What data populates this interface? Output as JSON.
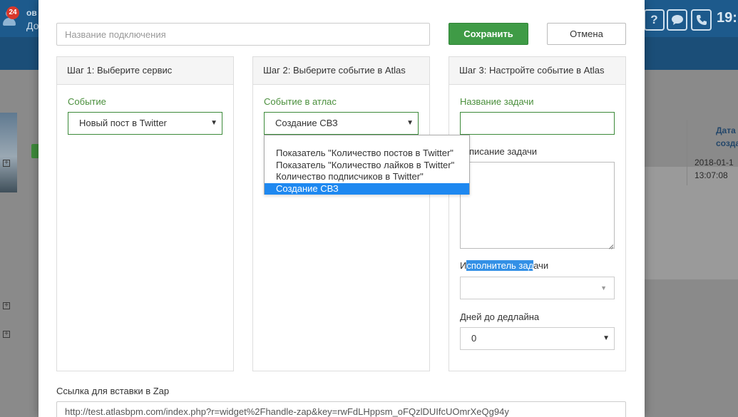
{
  "background": {
    "notification_count": "24",
    "user_line1": "ов",
    "user_line2": "До",
    "toolbar_help": "?",
    "clock": "19:",
    "table_header": "Дата созда",
    "table_cell": "2018-01-1 13:07:08"
  },
  "form": {
    "connection_name_placeholder": "Название подключения",
    "save_label": "Сохранить",
    "cancel_label": "Отмена",
    "zap_link_label": "Ссылка для вставки в Zap",
    "zap_link_value": "http://test.atlasbpm.com/index.php?r=widget%2Fhandle-zap&key=rwFdLHppsm_oFQzlDUIfcUOmrXeQg94y"
  },
  "step1": {
    "title": "Шаг 1: Выберите сервис",
    "event_label": "Событие",
    "event_value": "Новый пост в Twitter"
  },
  "step2": {
    "title": "Шаг 2: Выберите событие в Atlas",
    "event_label": "Событие в атлас",
    "event_value": "Создание СВЗ",
    "options": [
      "Показатель \"Количество постов в Twitter\"",
      "Показатель \"Количество лайков в Twitter\"",
      "Количество подписчиков в Twitter\"",
      "Создание СВЗ"
    ]
  },
  "step3": {
    "title": "Шаг 3: Настройте событие в Atlas",
    "task_name_label": "Название задачи",
    "task_desc_label": "Описание задачи",
    "task_desc_visible": "писание задачи",
    "assignee_label_pre": "И",
    "assignee_label_sel": "сполнитель зад",
    "assignee_label_post": "ачи",
    "deadline_label": "Дней до дедлайна",
    "deadline_value": "0"
  },
  "colors": {
    "accent_green": "#3f9b46",
    "label_green": "#4a8f3c",
    "selection_blue": "#1e88f0",
    "topbar_blue": "#1d5a8c"
  }
}
